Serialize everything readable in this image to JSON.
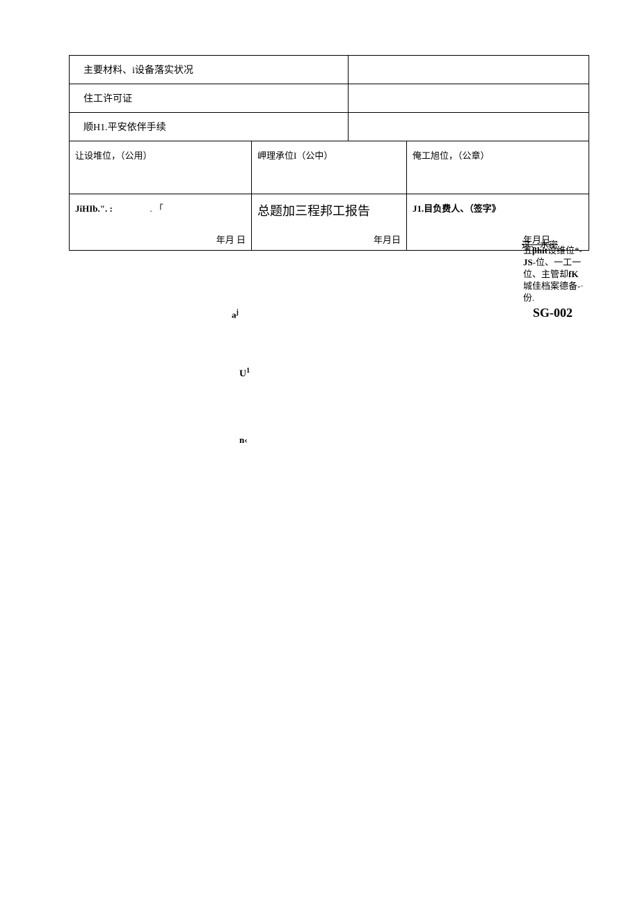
{
  "rows": {
    "r1_label": "主要材料、i设备落实状况",
    "r2_label": "住工许可证",
    "r3_label": "顺H1.平安依伴手续"
  },
  "sig_row": {
    "col1": "让设堆位，（公用）",
    "col2": "岬理承位I（公中）",
    "col3": "俺工旭位，（公章）"
  },
  "bottom_row": {
    "col1_a": "JiHIb.\". :",
    "col1_b": ". 「",
    "col1_date": "年月       日",
    "col2_title": "总题加三程邦工报告",
    "col2_date": "年月日",
    "col3_label": "J1.目负费人、（签字》",
    "col3_date": "年月日"
  },
  "strike": "这、水密",
  "note": {
    "l1a": "五",
    "l1b": "βhit",
    "l1c": "设维位*-",
    "l2a": "JS",
    "l2b": "-位、一工一",
    "l3a": "位、主管却",
    "l3b": "fK",
    "l4": "城佳档案德备-·",
    "l5": "份."
  },
  "code": "SG-002",
  "stray": {
    "a_base": "a",
    "a_sup": "j",
    "u_base": "U",
    "u_sup": "1",
    "n": "n‹"
  }
}
